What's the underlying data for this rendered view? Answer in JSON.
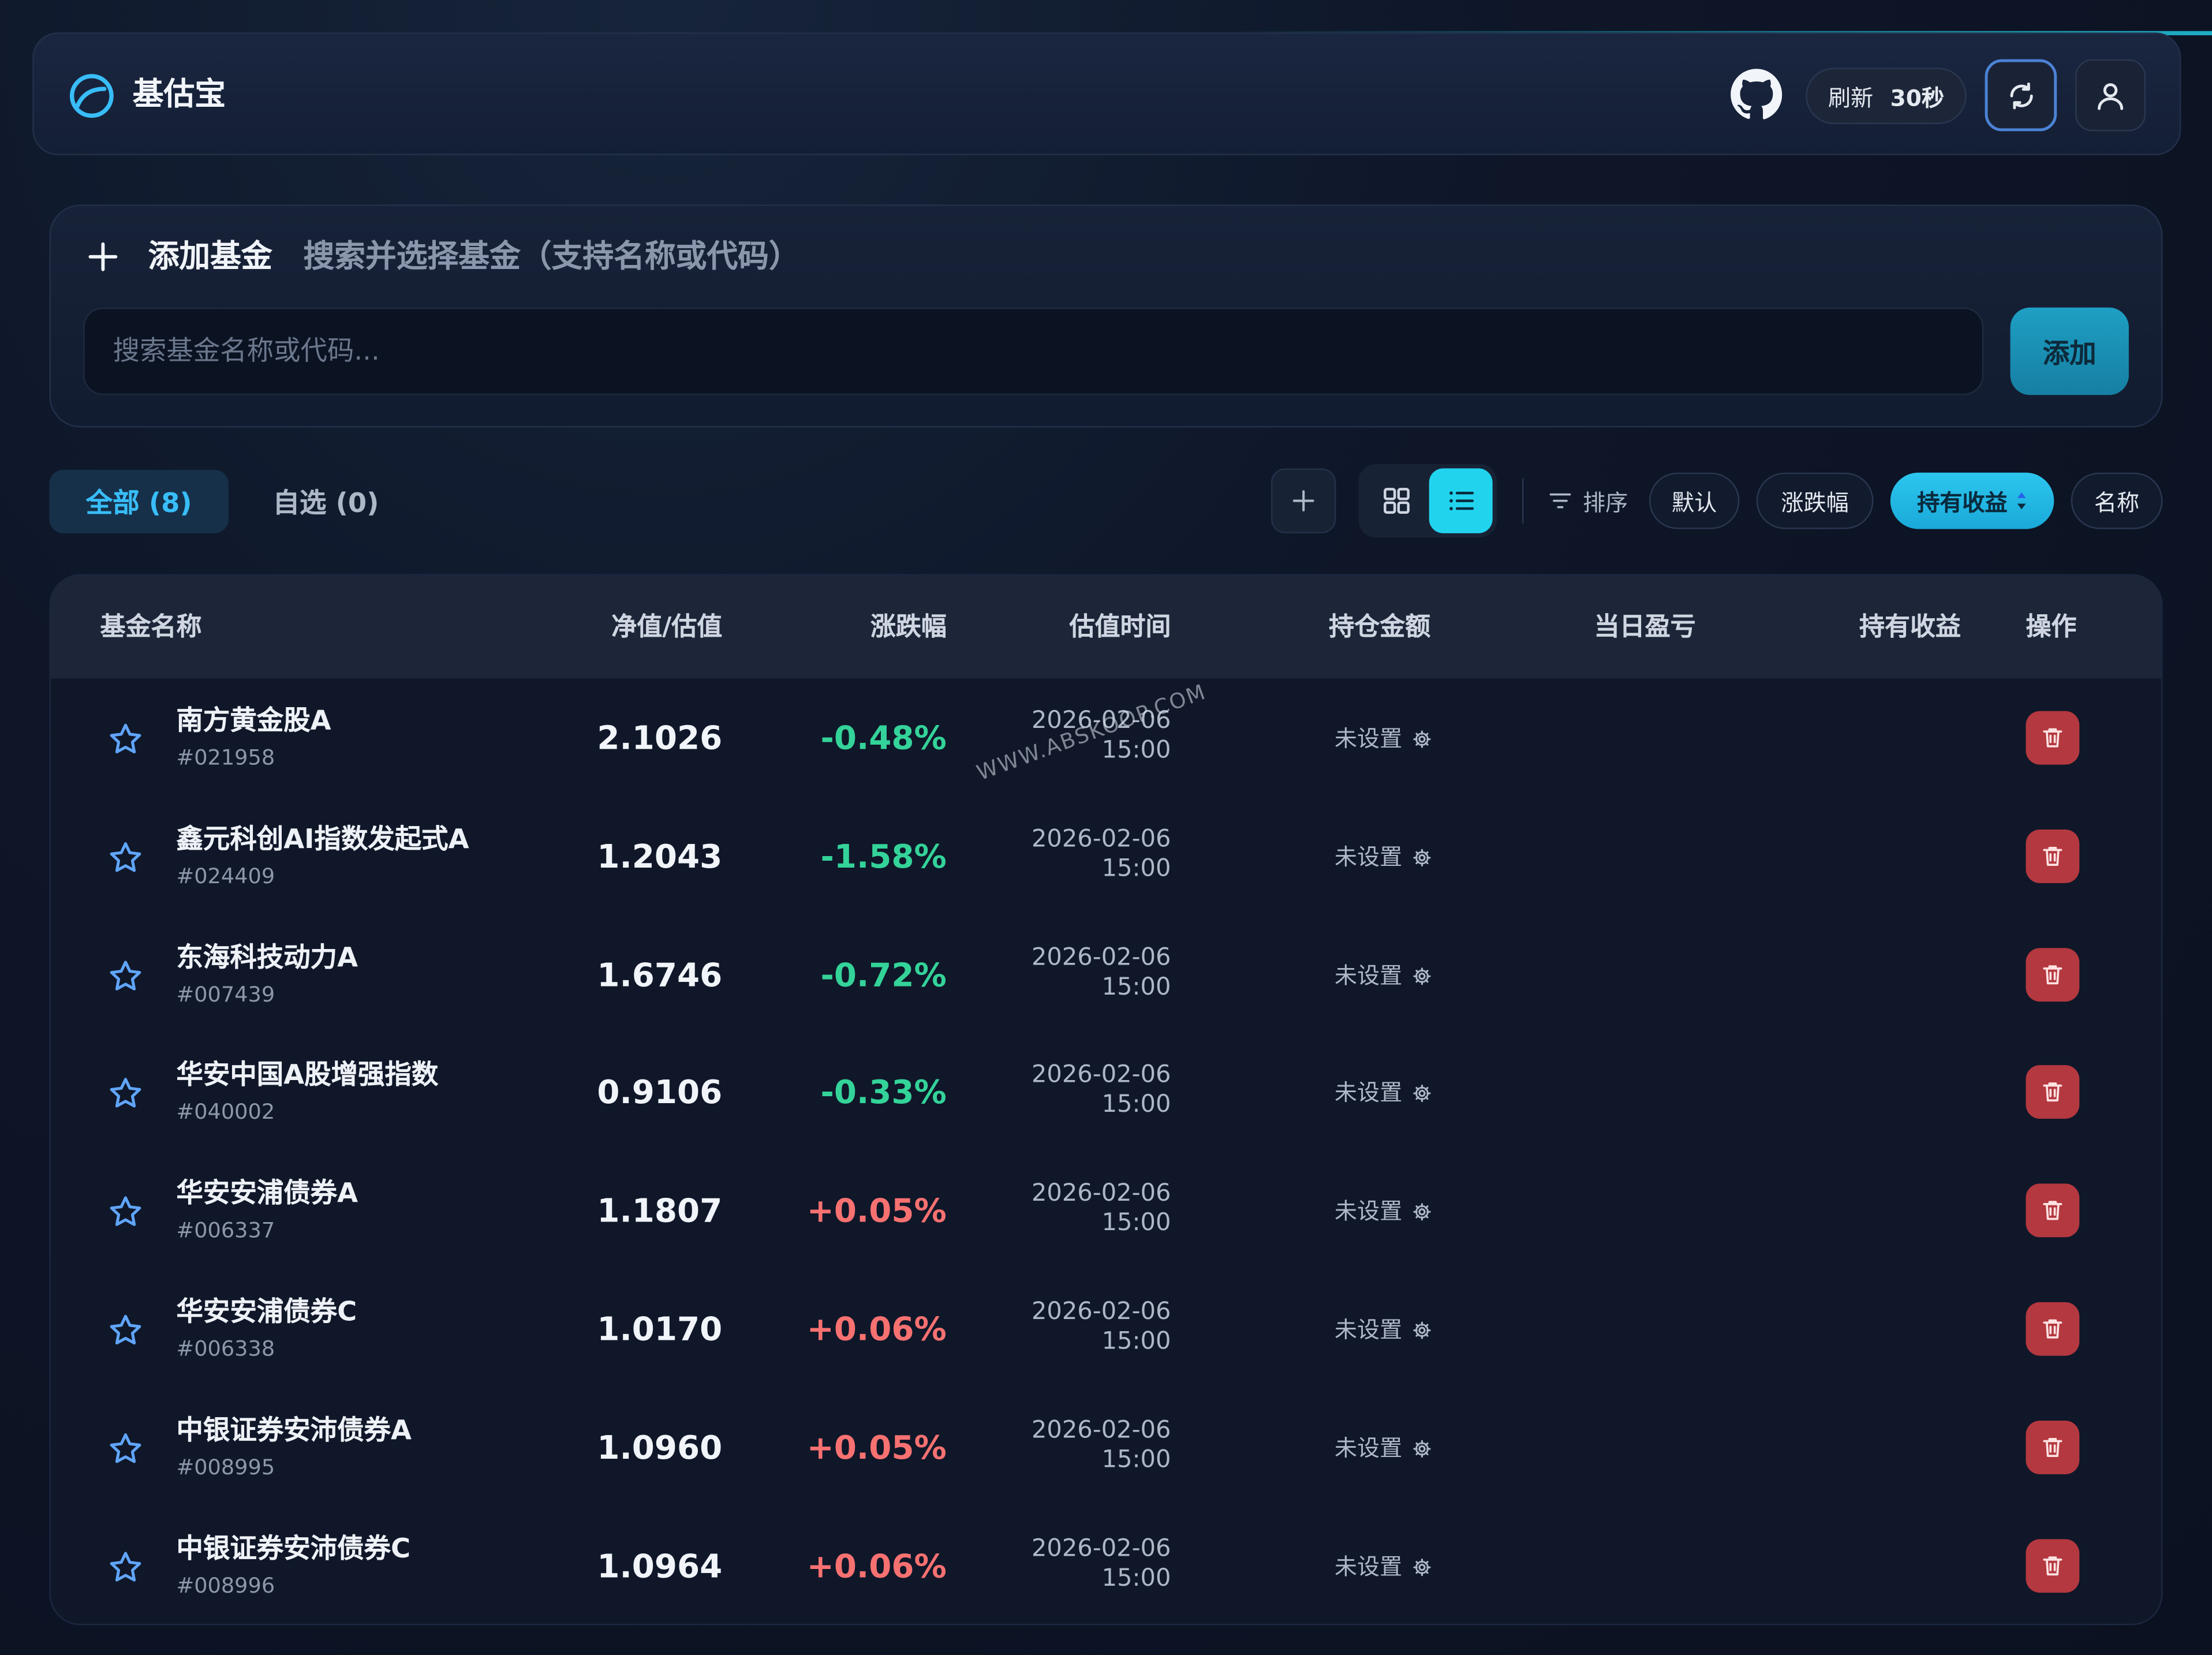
{
  "app": {
    "title": "基估宝"
  },
  "header": {
    "refresh_label": "刷新",
    "refresh_interval": "30秒"
  },
  "add_fund": {
    "title": "添加基金",
    "subtitle": "搜索并选择基金（支持名称或代码）",
    "search_placeholder": "搜索基金名称或代码...",
    "search_value": "",
    "add_button": "添加"
  },
  "tabs": {
    "all_label": "全部 (8)",
    "favorites_label": "自选 (0)"
  },
  "sort": {
    "label": "排序",
    "options": [
      "默认",
      "涨跌幅",
      "持有收益",
      "名称"
    ],
    "active": "持有收益"
  },
  "table": {
    "headers": {
      "name": "基金名称",
      "nav": "净值/估值",
      "change": "涨跌幅",
      "time": "估值时间",
      "holding": "持仓金额",
      "daily_pnl": "当日盈亏",
      "total_pnl": "持有收益",
      "actions": "操作"
    },
    "rows": [
      {
        "name": "南方黄金股A",
        "code": "#021958",
        "nav": "2.1026",
        "change": "-0.48%",
        "direction": "down",
        "date": "2026-02-06",
        "time": "15:00",
        "holding": "未设置"
      },
      {
        "name": "鑫元科创AI指数发起式A",
        "code": "#024409",
        "nav": "1.2043",
        "change": "-1.58%",
        "direction": "down",
        "date": "2026-02-06",
        "time": "15:00",
        "holding": "未设置"
      },
      {
        "name": "东海科技动力A",
        "code": "#007439",
        "nav": "1.6746",
        "change": "-0.72%",
        "direction": "down",
        "date": "2026-02-06",
        "time": "15:00",
        "holding": "未设置"
      },
      {
        "name": "华安中国A股增强指数",
        "code": "#040002",
        "nav": "0.9106",
        "change": "-0.33%",
        "direction": "down",
        "date": "2026-02-06",
        "time": "15:00",
        "holding": "未设置"
      },
      {
        "name": "华安安浦债券A",
        "code": "#006337",
        "nav": "1.1807",
        "change": "+0.05%",
        "direction": "up",
        "date": "2026-02-06",
        "time": "15:00",
        "holding": "未设置"
      },
      {
        "name": "华安安浦债券C",
        "code": "#006338",
        "nav": "1.0170",
        "change": "+0.06%",
        "direction": "up",
        "date": "2026-02-06",
        "time": "15:00",
        "holding": "未设置"
      },
      {
        "name": "中银证券安沛债券A",
        "code": "#008995",
        "nav": "1.0960",
        "change": "+0.05%",
        "direction": "up",
        "date": "2026-02-06",
        "time": "15:00",
        "holding": "未设置"
      },
      {
        "name": "中银证券安沛债券C",
        "code": "#008996",
        "nav": "1.0964",
        "change": "+0.06%",
        "direction": "up",
        "date": "2026-02-06",
        "time": "15:00",
        "holding": "未设置"
      }
    ]
  },
  "watermark": "WWW.ABSKOOP.COM",
  "colors": {
    "accent": "#22d3ee",
    "down": "#34d399",
    "up": "#f87171",
    "delete": "#b4383f",
    "star": "#60a5fa"
  },
  "icons": {
    "logo": "logo-ring-icon",
    "github": "github-icon",
    "refresh": "refresh-icon",
    "user": "user-icon",
    "add": "plus-icon",
    "grid": "grid-view-icon",
    "list": "list-view-icon",
    "sort": "filter-icon",
    "favorite": "star-icon",
    "settings": "gear-icon",
    "delete": "trash-icon"
  }
}
